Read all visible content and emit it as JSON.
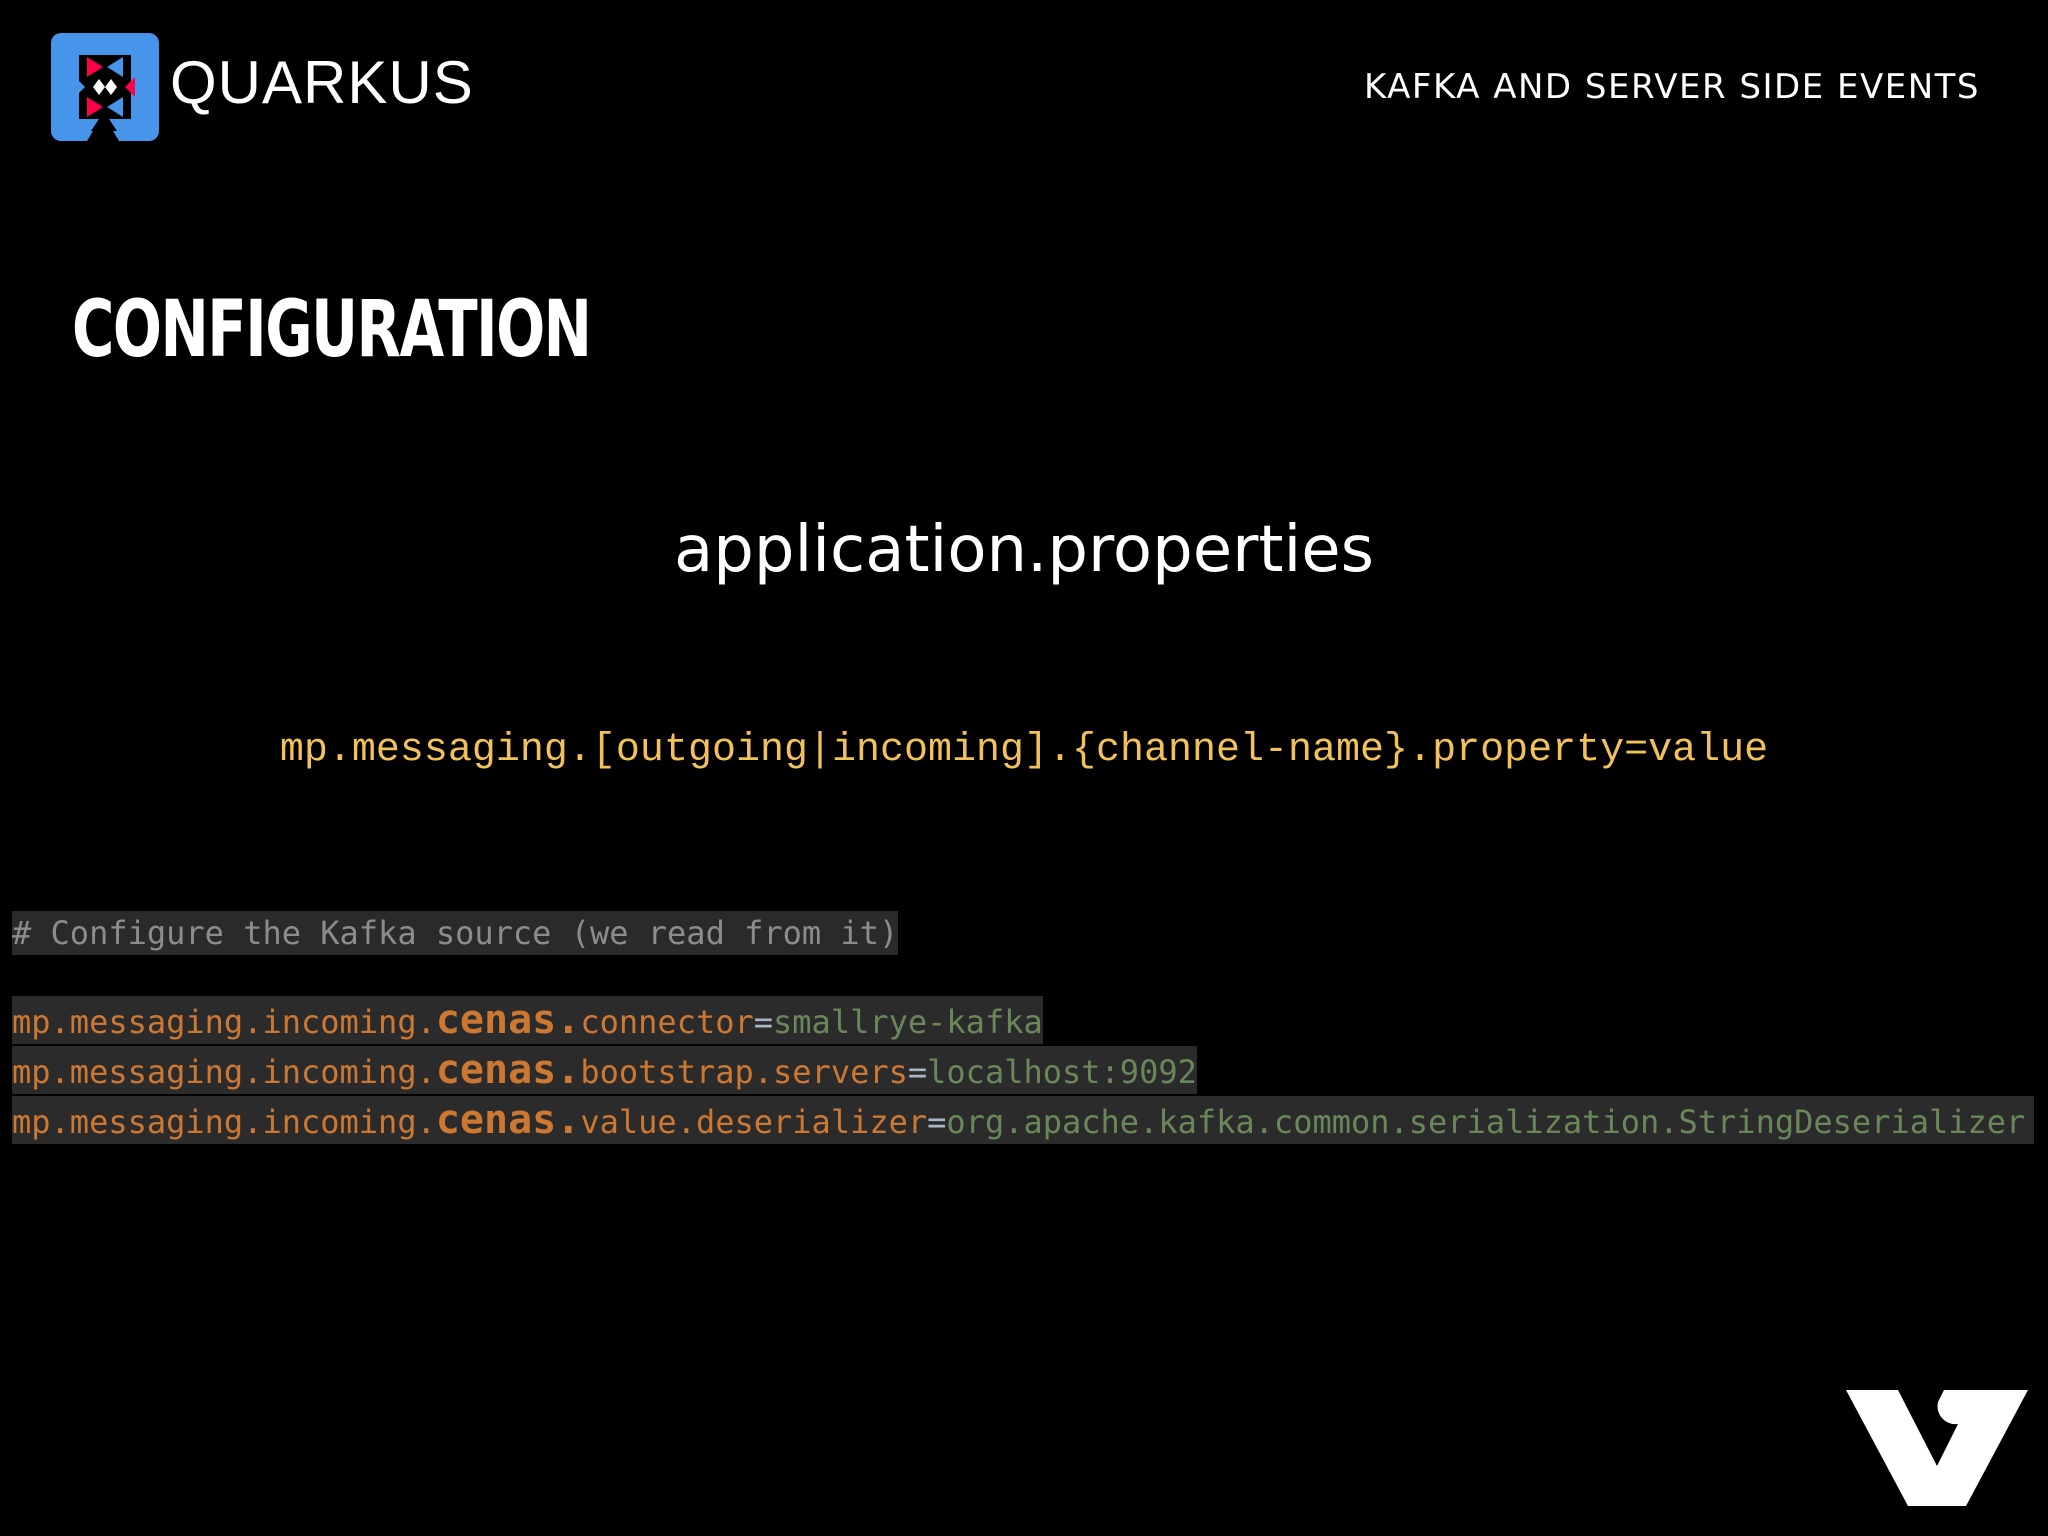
{
  "header": {
    "logo_text": "QUARKUS",
    "title": "KAFKA AND SERVER SIDE EVENTS"
  },
  "slide": {
    "title": "CONFIGURATION",
    "file_name": "application.properties",
    "pattern": "mp.messaging.[outgoing|incoming].{channel-name}.property=value"
  },
  "code": {
    "comment": "# Configure the Kafka source (we read from it)",
    "lines": [
      {
        "prefix": "mp.messaging.incoming.",
        "channel": "cenas",
        "dot": ".",
        "key": "connector",
        "eq": "=",
        "value": "smallrye-kafka"
      },
      {
        "prefix": "mp.messaging.incoming.",
        "channel": "cenas",
        "dot": ".",
        "key": "bootstrap.servers",
        "eq": "=",
        "value": "localhost:9092"
      },
      {
        "prefix": "mp.messaging.incoming.",
        "channel": "cenas",
        "dot": ".",
        "key": "value.deserializer",
        "eq": "=",
        "value": "org.apache.kafka.common.serialization.StringDeserializer"
      }
    ]
  },
  "icons": {
    "logo": "quarkus-logo-icon",
    "brand": "v-brand-icon"
  },
  "colors": {
    "background": "#000000",
    "pattern": "#f3c15a",
    "code_key": "#cc7832",
    "code_value": "#6a8759",
    "code_comment": "#8c8c8c",
    "code_bg": "#2b2b2b",
    "logo_blue": "#4695eb",
    "logo_red": "#ff004a"
  }
}
